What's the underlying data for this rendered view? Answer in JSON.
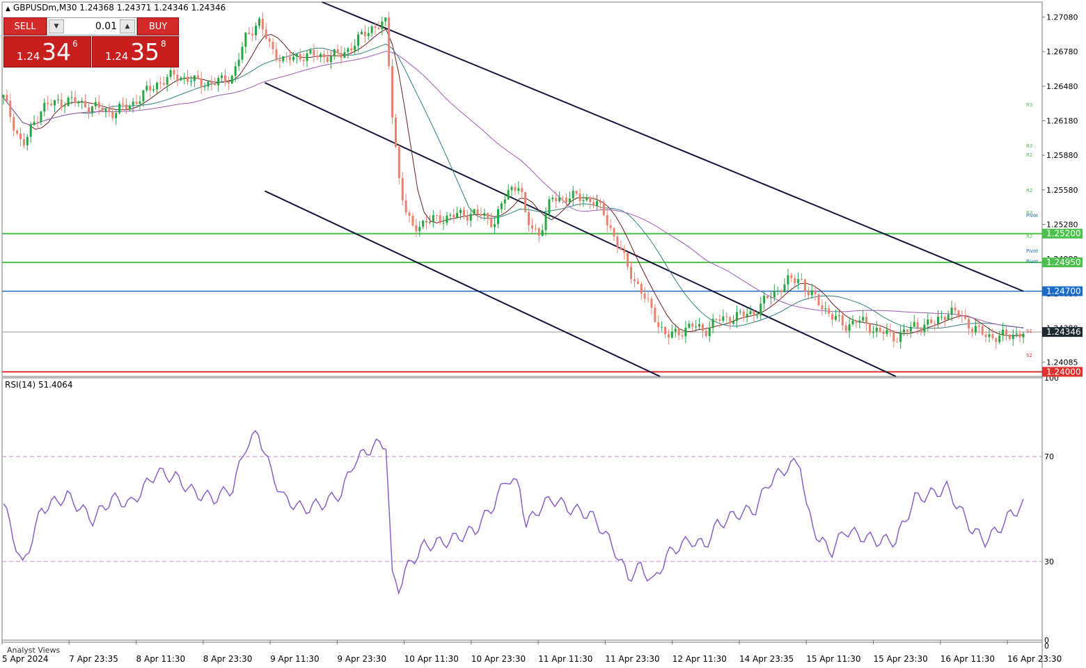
{
  "header": {
    "symbol_info": "GBPUSDm,M30  1.24368 1.24371 1.24346 1.24346"
  },
  "ticket": {
    "sell_label": "SELL",
    "buy_label": "BUY",
    "lot": "0.01",
    "sell_price": {
      "small": "1.24",
      "big": "34",
      "sup": "6"
    },
    "buy_price": {
      "small": "1.24",
      "big": "35",
      "sup": "8"
    }
  },
  "colors": {
    "bull": "#26a641",
    "bear": "#e8826e",
    "ma_fast": "#6b1d1d",
    "ma_mid": "#2f7f7f",
    "ma_slow": "#9c5ab8",
    "rsi": "#8860c8",
    "channel": "#14143c",
    "support": "#e03030",
    "resist": "#4cc04c",
    "level_blue": "#1a6cc8"
  },
  "chart_data": [
    {
      "type": "candlestick",
      "symbol": "GBPUSDm",
      "timeframe": "M30",
      "ohlc": {
        "open": 1.24368,
        "high": 1.24371,
        "low": 1.24346,
        "close": 1.24346
      },
      "ylim": [
        1.2396,
        1.2721
      ],
      "price_ticks": [
        "1.27080",
        "1.26780",
        "1.26480",
        "1.26180",
        "1.25880",
        "1.25580",
        "1.25280",
        "1.24980",
        "1.24680",
        "1.24380",
        "1.24085"
      ],
      "x_ticks": [
        "5 Apr 2024",
        "7 Apr 23:35",
        "8 Apr 11:30",
        "8 Apr 23:30",
        "9 Apr 11:30",
        "9 Apr 23:30",
        "10 Apr 11:30",
        "10 Apr 23:30",
        "11 Apr 11:30",
        "11 Apr 23:30",
        "12 Apr 11:30",
        "14 Apr 23:35",
        "15 Apr 11:30",
        "15 Apr 23:30",
        "16 Apr 11:30",
        "16 Apr 23:30"
      ],
      "close_path": [
        [
          0,
          1.2638
        ],
        [
          3,
          1.2595
        ],
        [
          6,
          1.263
        ],
        [
          10,
          1.2636
        ],
        [
          14,
          1.263
        ],
        [
          17,
          1.2625
        ],
        [
          20,
          1.2632
        ],
        [
          24,
          1.265
        ],
        [
          27,
          1.2658
        ],
        [
          30,
          1.2652
        ],
        [
          33,
          1.265
        ],
        [
          36,
          1.2657
        ],
        [
          38,
          1.269
        ],
        [
          40,
          1.2705
        ],
        [
          42,
          1.268
        ],
        [
          44,
          1.267
        ],
        [
          47,
          1.2675
        ],
        [
          50,
          1.2674
        ],
        [
          53,
          1.2675
        ],
        [
          55,
          1.2685
        ],
        [
          58,
          1.27
        ],
        [
          60,
          1.2702
        ],
        [
          61,
          1.2625
        ],
        [
          62,
          1.257
        ],
        [
          63,
          1.254
        ],
        [
          64,
          1.2525
        ],
        [
          66,
          1.253
        ],
        [
          70,
          1.2535
        ],
        [
          74,
          1.2538
        ],
        [
          77,
          1.253
        ],
        [
          79,
          1.2555
        ],
        [
          81,
          1.2565
        ],
        [
          82,
          1.253
        ],
        [
          84,
          1.252
        ],
        [
          86,
          1.255
        ],
        [
          89,
          1.2552
        ],
        [
          92,
          1.255
        ],
        [
          94,
          1.254
        ],
        [
          96,
          1.2515
        ],
        [
          98,
          1.249
        ],
        [
          100,
          1.247
        ],
        [
          102,
          1.245
        ],
        [
          104,
          1.243
        ],
        [
          106,
          1.2435
        ],
        [
          108,
          1.244
        ],
        [
          110,
          1.2436
        ],
        [
          112,
          1.2445
        ],
        [
          115,
          1.2448
        ],
        [
          118,
          1.2452
        ],
        [
          120,
          1.2465
        ],
        [
          123,
          1.2478
        ],
        [
          125,
          1.2482
        ],
        [
          126,
          1.247
        ],
        [
          128,
          1.246
        ],
        [
          130,
          1.2448
        ],
        [
          132,
          1.244
        ],
        [
          134,
          1.2445
        ],
        [
          137,
          1.2436
        ],
        [
          140,
          1.243
        ],
        [
          143,
          1.244
        ],
        [
          146,
          1.2442
        ],
        [
          148,
          1.2452
        ],
        [
          150,
          1.245
        ],
        [
          152,
          1.2438
        ],
        [
          154,
          1.2432
        ],
        [
          156,
          1.243
        ],
        [
          158,
          1.2432
        ],
        [
          160,
          1.2434
        ]
      ]
    },
    {
      "type": "line",
      "title": "RSI(14) 51.4064",
      "series": [
        {
          "values": [
            [
              0,
              52
            ],
            [
              3,
              28
            ],
            [
              6,
              50
            ],
            [
              10,
              55
            ],
            [
              14,
              46
            ],
            [
              17,
              54
            ],
            [
              20,
              52
            ],
            [
              24,
              64
            ],
            [
              27,
              62
            ],
            [
              30,
              56
            ],
            [
              33,
              54
            ],
            [
              36,
              58
            ],
            [
              38,
              74
            ],
            [
              40,
              79
            ],
            [
              42,
              64
            ],
            [
              44,
              54
            ],
            [
              47,
              50
            ],
            [
              50,
              52
            ],
            [
              53,
              56
            ],
            [
              55,
              68
            ],
            [
              58,
              74
            ],
            [
              60,
              75
            ],
            [
              61,
              24
            ],
            [
              62,
              20
            ],
            [
              63,
              26
            ],
            [
              64,
              30
            ],
            [
              66,
              36
            ],
            [
              70,
              38
            ],
            [
              74,
              42
            ],
            [
              77,
              52
            ],
            [
              79,
              62
            ],
            [
              81,
              58
            ],
            [
              82,
              44
            ],
            [
              84,
              50
            ],
            [
              86,
              54
            ],
            [
              89,
              50
            ],
            [
              92,
              48
            ],
            [
              94,
              42
            ],
            [
              96,
              34
            ],
            [
              98,
              24
            ],
            [
              100,
              28
            ],
            [
              102,
              22
            ],
            [
              104,
              32
            ],
            [
              106,
              36
            ],
            [
              108,
              38
            ],
            [
              110,
              36
            ],
            [
              112,
              44
            ],
            [
              115,
              48
            ],
            [
              118,
              50
            ],
            [
              120,
              60
            ],
            [
              123,
              66
            ],
            [
              125,
              68
            ],
            [
              126,
              50
            ],
            [
              128,
              38
            ],
            [
              130,
              34
            ],
            [
              132,
              42
            ],
            [
              134,
              40
            ],
            [
              137,
              38
            ],
            [
              140,
              38
            ],
            [
              143,
              54
            ],
            [
              146,
              56
            ],
            [
              148,
              58
            ],
            [
              150,
              50
            ],
            [
              152,
              42
            ],
            [
              154,
              38
            ],
            [
              156,
              42
            ],
            [
              158,
              48
            ],
            [
              160,
              51.4
            ]
          ]
        }
      ],
      "ylim": [
        0,
        100
      ],
      "levels": [
        30,
        70
      ],
      "y_ticks": [
        "100",
        "70",
        "30",
        "0"
      ]
    }
  ],
  "price_labels": {
    "resist1": "1.25200",
    "resist2": "1.24950",
    "blue": "1.24700",
    "current": "1.24346",
    "support": "1.24000"
  },
  "pivot_labels": [
    "R3",
    "R3",
    "R2",
    "R2",
    "R3",
    "Pivot",
    "R2",
    "Pivot",
    "Pivot",
    "S1",
    "S2"
  ],
  "footer": {
    "label": "Analyst Views"
  },
  "rsi_extra_tick": "0"
}
